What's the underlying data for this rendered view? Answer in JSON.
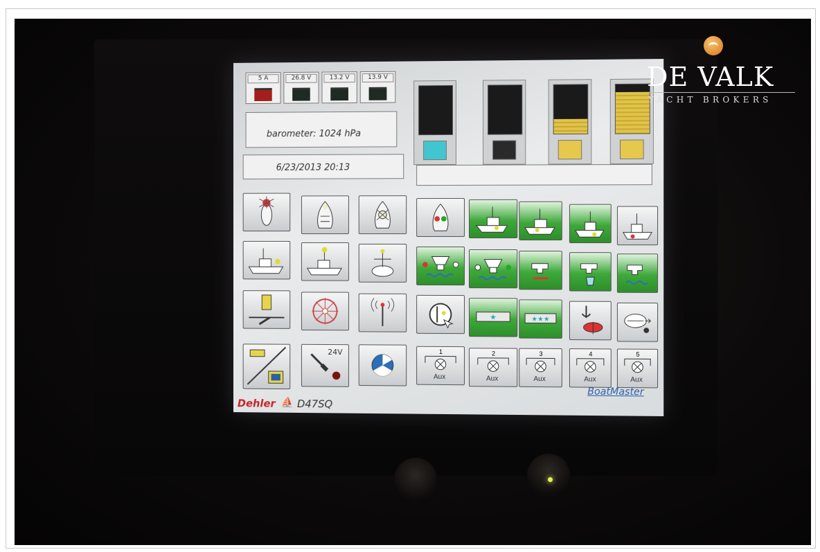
{
  "watermark": {
    "brand_name": "DE VALK",
    "brand_subtitle": "YACHT BROKERS",
    "icon": "falcon-logo-icon"
  },
  "display": {
    "batteries": [
      {
        "label": "5 A",
        "icon": "battery-icon",
        "color": "#a41e1e"
      },
      {
        "label": "26.8 V",
        "icon": "battery-icon",
        "color": "#1f2a22"
      },
      {
        "label": "13.2 V",
        "icon": "battery-icon",
        "color": "#1f2a22"
      },
      {
        "label": "13.9 V",
        "icon": "battery-icon",
        "color": "#1f2a22"
      }
    ],
    "barometer": "barometer: 1024 hPa",
    "datetime": "6/23/2013  20:13",
    "tanks": [
      {
        "name": "water-tank",
        "level": 0,
        "icon": "water-tank-icon",
        "color": "#41c6d0"
      },
      {
        "name": "black-water-tank",
        "level": 0,
        "icon": "black-water-tank-icon",
        "color": "#1a1a1a"
      },
      {
        "name": "fuel-tank-1",
        "level": 0.3,
        "icon": "fuel-tank-icon",
        "color": "#e0c34a"
      },
      {
        "name": "fuel-tank-2",
        "level": 0.85,
        "icon": "fuel-tank-icon",
        "color": "#e0c34a"
      }
    ],
    "aux_label": "Aux",
    "aux_numbers": [
      "1",
      "2",
      "3",
      "4",
      "5"
    ],
    "voltage_label": "24V",
    "brand_left": "Dehler",
    "model": "D47SQ",
    "brand_right": "BoatMaster",
    "colors": {
      "on_green": "#3ea83a",
      "dehler_red": "#c8262a",
      "brand_blue": "#2b5fa8"
    }
  }
}
